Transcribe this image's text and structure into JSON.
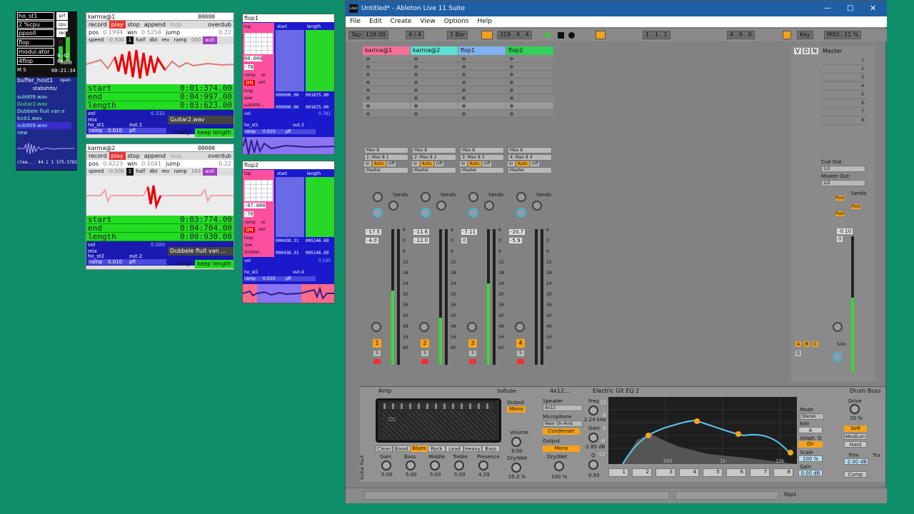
{
  "host": {
    "title": "ho_st1",
    "title_badge": "prf",
    "cpu": "2 %cpu",
    "cpu_badge": "cpu",
    "rows": [
      "ppooll",
      "flop",
      "modul.ator",
      "4flop"
    ],
    "row_badges": [
      "rec"
    ],
    "time_a": "0:42",
    "time_b": "04",
    "count": "0000",
    "clock": "00:21:34",
    "mode": "M",
    "mode_b": "S",
    "buffer_title": "buffer_host1",
    "buffer_open": "open",
    "buffer_folder": "stabshits/",
    "buffer_items": [
      "sub909.wav",
      "Guitar2.wav",
      "Dubbele fluit van e",
      "kick1.wav",
      "sub909.wav",
      "new"
    ],
    "footer_a": "clea...",
    "footer_b": "44.1",
    "footer_c": "1",
    "footer_d": "575.5782"
  },
  "karma1": {
    "title": "karma@1",
    "counter": "00000",
    "buttons": [
      "record",
      "play",
      "stop",
      "append",
      "loop",
      "overdub"
    ],
    "pos_label": "pos",
    "pos_value": "0.1994",
    "win_label": "win",
    "win_value": "0.5258",
    "jump": "jump",
    "jump_val": "0.22",
    "speed_label": "speed",
    "speed_value": "-0.500",
    "speed_b": "1",
    "half": "half",
    "dbl": "dbl",
    "rev": "rev",
    "ramp": "ramp",
    "ramp_val": "000",
    "auto": "auti",
    "start_label": "start",
    "start_value": "0:01:374.00",
    "end_label": "end",
    "end_value": "0:04:997.00",
    "length_label": "length",
    "length_value": "0:03:623.00",
    "vol_label": "vol",
    "vol_value": "0.332",
    "file": "Guitar2.wav",
    "mix": "mix",
    "host": "ho_st1",
    "out": "out.1",
    "ramp2": "ramp",
    "ramp2_val": "0.010",
    "pfl": "pfl",
    "crazy": "crazy",
    "keep": "keep length"
  },
  "karma2": {
    "title": "karma@2",
    "counter": "00000",
    "buttons": [
      "record",
      "play",
      "stop",
      "append",
      "loop",
      "overdub"
    ],
    "pos_label": "pos",
    "pos_value": "0.4223",
    "win_label": "win",
    "win_value": "0.1041",
    "jump": "jump",
    "jump_val": "0.22",
    "speed_label": "speed",
    "speed_value": "-0.500",
    "speed_b": "1",
    "half": "half",
    "dbl": "dbl",
    "rev": "rev",
    "ramp": "ramp",
    "ramp_val": "143",
    "auto": "auti",
    "start_label": "start",
    "start_value": "0:03:774.00",
    "end_label": "end",
    "end_value": "0:04:704.00",
    "length_label": "length",
    "length_value": "0:00:930.00",
    "vol_label": "vol",
    "vol_value": "0.000",
    "file": "Dubbele fluit van ...",
    "mix": "mix",
    "host": "ho_st2",
    "out": "out.2",
    "ramp2": "ramp",
    "ramp2_val": "0.010",
    "pfl": "pfl",
    "crazy": "crazy",
    "keep": "keep length"
  },
  "flop1": {
    "title": "flop1",
    "top": "top",
    "start": "start",
    "length": "length",
    "v1": "00.000",
    "v2": "-70",
    "ramp": "ramp",
    "st": "st",
    "on": "ON",
    "ext": "ext",
    "loop": "loop",
    "saw": "saw",
    "file": "sub909...",
    "n1": "000000.00",
    "n2": "001875.00",
    "n3": "000000.00",
    "n4": "001875.00",
    "vol": "vol",
    "vol_val": "0.781",
    "host": "ho_st1",
    "out": "out.3",
    "ramp2": "ramp",
    "ramp2_val": "0.010",
    "pfl": "pfl"
  },
  "flop2": {
    "title": "flop2",
    "top": "top",
    "start": "start",
    "length": "length",
    "v1": "-07.000",
    "v2": "-70",
    "ramp": "ramp",
    "st": "st",
    "on": "ON",
    "ext": "ext",
    "loop": "loop",
    "saw": "saw",
    "file": "Dubbel...",
    "n1": "000438.31",
    "n2": "005146.69",
    "n3": "000438.31",
    "n4": "005146.69",
    "vol": "vol",
    "vol_val": "0.190",
    "host": "ho_st1",
    "out": "out.4",
    "ramp2": "ramp",
    "ramp2_val": "0.010",
    "pfl": "pfl"
  },
  "ableton": {
    "logo": "Live",
    "title": "Untitled* - Ableton Live 11 Suite",
    "menu": [
      "File",
      "Edit",
      "Create",
      "View",
      "Options",
      "Help"
    ],
    "transport": {
      "tap": "Tap",
      "bpm": "128.00",
      "sig": "4 / 4",
      "bar": "1 Bar",
      "pos": "219 .  4 .  4",
      "loop_start": "1 .  1 .  1",
      "loop_len": "4 .  0 .  0",
      "key": "Key",
      "midi": "MIDI",
      "zoom": "21 %"
    },
    "tracks": [
      {
        "name": "karma@1",
        "color": "#f7709a",
        "input": "Max 8",
        "channel": "1: Max 8 1",
        "in": "In",
        "auto": "Auto",
        "off": "Off",
        "out": "Master",
        "sends": "Sends",
        "vol": "-17.5",
        "pk": "-4.0",
        "num": "1",
        "s": "S",
        "meter": 0.55
      },
      {
        "name": "karma@2",
        "color": "#5de0d0",
        "input": "Max 8",
        "channel": "2: Max 8 2",
        "in": "In",
        "auto": "Auto",
        "off": "Off",
        "out": "Master",
        "sends": "Sends",
        "vol": "-11.6",
        "pk": "-12.0",
        "num": "2",
        "s": "S",
        "meter": 0.35
      },
      {
        "name": "flop1",
        "color": "#7fb2f2",
        "input": "Max 8",
        "channel": "3: Max 8 3",
        "in": "In",
        "auto": "Auto",
        "off": "Off",
        "out": "Master",
        "sends": "Sends",
        "vol": "-7.11",
        "pk": "0",
        "num": "3",
        "s": "S",
        "meter": 0.6
      },
      {
        "name": "flop2",
        "color": "#30d05a",
        "input": "Max 8",
        "channel": "4: Max 8 4",
        "in": "In",
        "auto": "Auto",
        "off": "Off",
        "out": "Master",
        "sends": "Sends",
        "vol": "-20.7",
        "pk": "-5.9",
        "num": "4",
        "s": "S",
        "meter": 0.0
      }
    ],
    "db_scale": [
      "6",
      "0",
      "6",
      "12",
      "18",
      "24",
      "30",
      "36",
      "42",
      "48",
      "54",
      "60"
    ],
    "master": {
      "name": "Master",
      "v": "V",
      "d": "D",
      "n": "N",
      "scenes": [
        "1",
        "2",
        "3",
        "4",
        "5",
        "6",
        "7",
        "8"
      ],
      "cue_out": "Cue Out",
      "cue_val": "1/2",
      "master_out": "Master Out",
      "master_val": "1/2",
      "sends": "Sends",
      "post": "Post",
      "vol": "-0.10",
      "pk": "0",
      "solo": "Solo",
      "meter": 0.55
    },
    "returns": {
      "a": "A",
      "b": "B",
      "c": "C",
      "s": "S"
    },
    "amp": {
      "title": "Amp",
      "softube": "Softube",
      "types": [
        "Clean",
        "Boost",
        "Blues",
        "Rock",
        "Lead",
        "Heavy",
        "Bass"
      ],
      "knobs": [
        {
          "l": "Gain",
          "v": "5.00"
        },
        {
          "l": "Bass",
          "v": "5.00"
        },
        {
          "l": "Middle",
          "v": "5.00"
        },
        {
          "l": "Treble",
          "v": "5.00"
        },
        {
          "l": "Presence",
          "v": "4.29"
        }
      ],
      "output": "Output",
      "mono": "Mono",
      "volume": "Volume",
      "volume_val": "9.00",
      "drywet": "Dry/Wet",
      "drywet_val": "25.0 %",
      "rack": "Guitar Rack"
    },
    "cab": {
      "title": "4x12...",
      "speaker": "Speaker",
      "speaker_val": "4x12",
      "mic": "Microphone",
      "mic_val": "Near On-Axis",
      "condenser": "Condenser",
      "output": "Output",
      "mono": "Mono",
      "drywet": "Dry/Wet",
      "drywet_val": "100 %"
    },
    "eq": {
      "title": "Electric Git EQ 2",
      "freq": "Freq",
      "freq_val": "2.24 kHz",
      "gain": "Gain",
      "gain_val": "-2.85 dB",
      "q": "Q",
      "q_val": "0.93",
      "grid": [
        "12",
        "6",
        "0",
        "-6",
        "-12"
      ],
      "freqs": [
        "100",
        "1k",
        "10k"
      ],
      "mode": "Mode",
      "mode_val": "Stereo",
      "edit": "Edit",
      "edit_val": "A",
      "adapt": "Adapt. Q",
      "adapt_val": "On",
      "scale": "Scale",
      "scale_val": "100 %",
      "gain2": "Gain",
      "gain2_val": "0.00 dB",
      "bands": [
        "1",
        "2",
        "3",
        "4",
        "5",
        "6",
        "7",
        "8"
      ]
    },
    "drum": {
      "title": "Drum Buss",
      "drive": "Drive",
      "drive_val": "20 %",
      "soft": "Soft",
      "medium": "Medium",
      "hard": "Hard",
      "trim": "Trim",
      "trim_val": "-2.00 dB",
      "comp": "Comp",
      "tra": "Tra"
    },
    "status": {
      "clip": "flop1"
    }
  }
}
